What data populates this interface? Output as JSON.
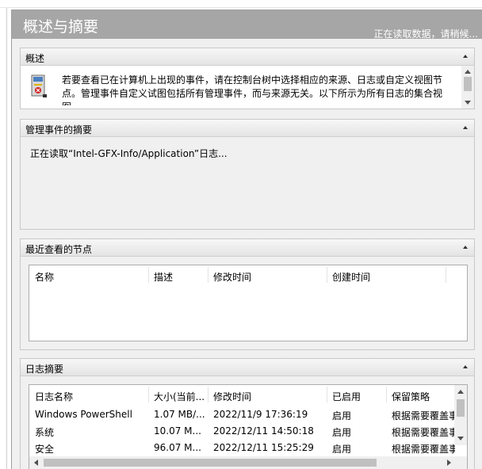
{
  "header": {
    "title": "概述与摘要",
    "status": "正在读取数据，请稍候..."
  },
  "overview": {
    "title": "概述",
    "icon": "event-log-icon",
    "text": "若要查看已在计算机上出现的事件，请在控制台树中选择相应的来源、日志或自定义视图节点。管理事件自定义试图包括所有管理事件，而与来源无关。以下所示为所有日志的集合视图。"
  },
  "admin_events": {
    "title": "管理事件的摘要",
    "reading": "正在读取“Intel-GFX-Info/Application”日志..."
  },
  "recent_nodes": {
    "title": "最近查看的节点",
    "columns": [
      "名称",
      "描述",
      "修改时间",
      "创建时间"
    ]
  },
  "log_summary": {
    "title": "日志摘要",
    "columns": [
      "日志名称",
      "大小(当前...",
      "修改时间",
      "已启用",
      "保留策略"
    ],
    "rows": [
      [
        "Windows PowerShell",
        "1.07 MB/...",
        "2022/11/9 17:36:19",
        "启用",
        "根据需要覆盖事"
      ],
      [
        "系统",
        "10.07 M...",
        "2022/12/11 14:50:18",
        "启用",
        "根据需要覆盖事"
      ],
      [
        "安全",
        "96.07 M...",
        "2022/12/11 15:25:29",
        "启用",
        "根据需要覆盖事"
      ]
    ]
  },
  "colors": {
    "header_bg": "#a6a6a6",
    "panel_bg": "#f0f0f0"
  }
}
